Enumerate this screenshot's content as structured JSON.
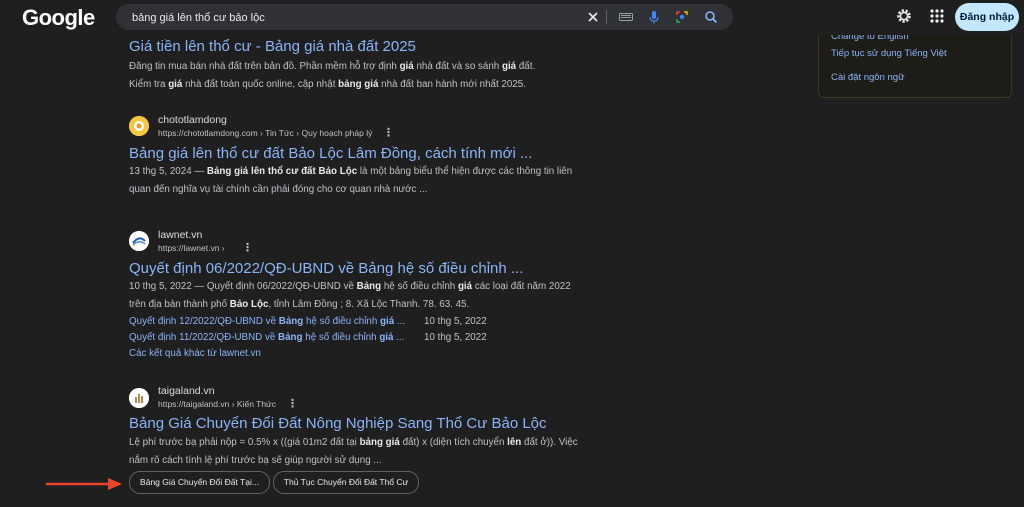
{
  "header": {
    "logo": "Google",
    "search_value": "bảng giá lên thổ cư bảo lộc",
    "login_label": "Đăng nhập"
  },
  "language_panel": {
    "items": [
      "Change to English",
      "Tiếp tục sử dụng Tiếng Việt",
      "Cài đặt ngôn ngữ"
    ]
  },
  "result0": {
    "title": "Giá tiền lên thổ cư - Bảng giá nhà đất 2025",
    "snippet_lines": [
      [
        "Đăng tin mua bán nhà đất trên bản đồ. Phần mềm hỗ trợ định ",
        "giá",
        " nhà đất và so sánh ",
        "giá",
        " đất."
      ],
      [
        "Kiểm tra ",
        "giá",
        " nhà đất toàn quốc online, cập nhật ",
        "bảng giá",
        " nhà đất ban hành mới nhất 2025."
      ]
    ]
  },
  "result1": {
    "site": "chototlamdong",
    "url": "https://chototlamdong.com › Tin Tức › Quy hoạch pháp lý",
    "title": "Bảng giá lên thổ cư đất Bảo Lộc Lâm Đồng, cách tính mới ...",
    "snippet_lines": [
      [
        "13 thg 5, 2024 — ",
        "Bảng giá lên thổ cư đất Bảo Lộc",
        " là một bảng biểu thể hiện được các thông tin liên"
      ],
      [
        "quan đến nghĩa vụ tài chính cần phải đóng cho cơ quan nhà nước ..."
      ]
    ]
  },
  "result2": {
    "site": "lawnet.vn",
    "url": "https://lawnet.vn ›",
    "title": "Quyết định 06/2022/QĐ-UBND về Bảng hệ số điều chỉnh ...",
    "snippet_lines": [
      [
        "10 thg 5, 2022 — Quyết định 06/2022/QĐ-UBND về ",
        "Bảng",
        " hệ số điều chỉnh ",
        "giá",
        " các loại đất năm 2022"
      ],
      [
        "trên địa bàn thành phố ",
        "Bảo Lộc",
        ", tỉnh Lâm Đồng ; 8. Xã Lộc Thanh. 78. 63. 45."
      ]
    ],
    "sublinks": [
      {
        "parts": [
          "Quyết định 12/2022/QĐ-UBND về ",
          "Bảng",
          " hệ số điều chỉnh ",
          "giá",
          " ..."
        ],
        "date": "10 thg 5, 2022"
      },
      {
        "parts": [
          "Quyết định 11/2022/QĐ-UBND về ",
          "Bảng",
          " hệ số điều chỉnh ",
          "giá",
          " ..."
        ],
        "date": "10 thg 5, 2022"
      }
    ],
    "more": "Các kết quả khác từ lawnet.vn"
  },
  "result3": {
    "site": "taigaland.vn",
    "url": "https://taigaland.vn › Kiến Thức",
    "title": "Bảng Giá Chuyển Đổi Đất Nông Nghiệp Sang Thổ Cư Bảo Lộc",
    "snippet_lines": [
      [
        "Lệ phí trước bạ phải nộp = 0.5% x ((giá 01m2 đất tại ",
        "bảng giá",
        " đất) x (diện tích chuyển ",
        "lên",
        " đất ở)). Việc"
      ],
      [
        "nắm rõ cách tính lệ phí trước bạ sẽ giúp người sử dụng ..."
      ]
    ],
    "chips": [
      "Bảng Giá Chuyển Đổi Đất Tại...",
      "Thủ Tục Chuyển Đổi Đất Thổ Cư"
    ]
  },
  "colors": {
    "background": "#1f1f1f",
    "link": "#8ab4f8",
    "text": "#bdc1c6",
    "annotation_arrow": "#e8452c",
    "login_button": "#c2e7ff"
  }
}
